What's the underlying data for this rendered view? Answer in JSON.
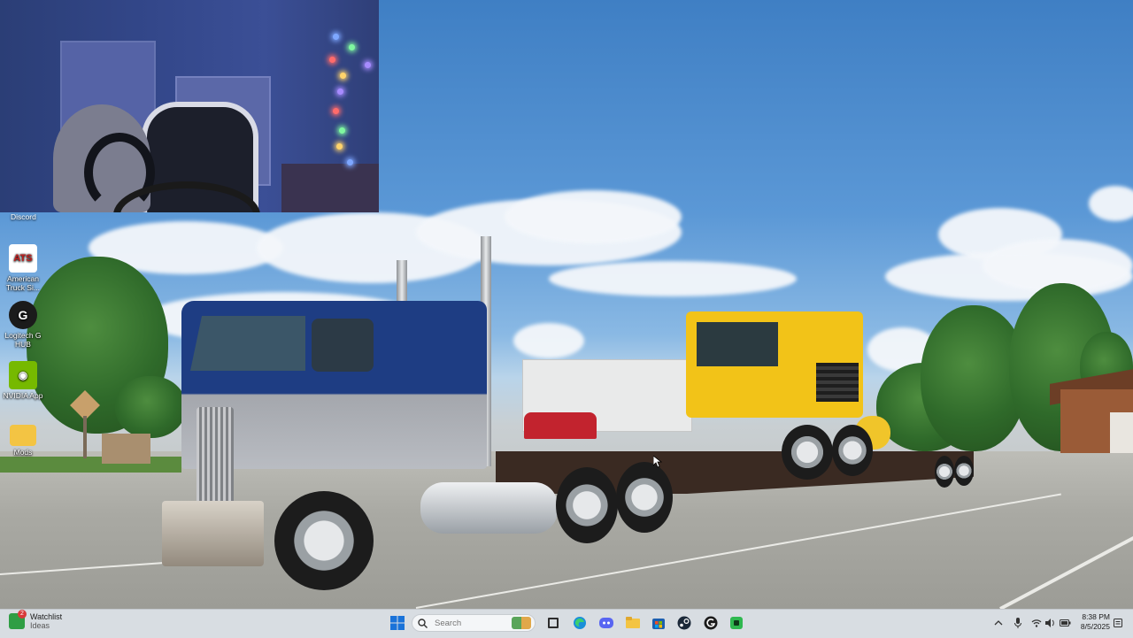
{
  "desktop": {
    "icons": [
      {
        "label": "Discord",
        "icon": "discord-icon"
      },
      {
        "label": "American Truck Si...",
        "icon": "american-truck-simulator-icon"
      },
      {
        "label": "Logitech G HUB",
        "icon": "logitech-g-hub-icon"
      },
      {
        "label": "NVIDIA App",
        "icon": "nvidia-app-icon"
      },
      {
        "label": "Mods",
        "icon": "folder-icon"
      }
    ],
    "colors": {
      "sky": "#4b87c9",
      "truck_blue": "#1e3d83",
      "machine_yellow": "#f2c318"
    }
  },
  "webcam": {
    "label": "webcam-overlay"
  },
  "taskbar": {
    "widget": {
      "title": "Watchlist",
      "subtitle": "Ideas",
      "badge": "2"
    },
    "search": {
      "placeholder": "Search"
    },
    "pinned": [
      {
        "name": "windows-start",
        "icon": "windows-logo-icon"
      },
      {
        "name": "task-view",
        "icon": "task-view-icon"
      },
      {
        "name": "edge",
        "icon": "edge-icon"
      },
      {
        "name": "discord",
        "icon": "discord-icon"
      },
      {
        "name": "file-explorer",
        "icon": "folder-icon"
      },
      {
        "name": "microsoft-store",
        "icon": "store-icon"
      },
      {
        "name": "steam",
        "icon": "steam-icon"
      },
      {
        "name": "logitech-g-hub",
        "icon": "logitech-g-hub-icon"
      },
      {
        "name": "app-green",
        "icon": "green-app-icon"
      }
    ],
    "tray": {
      "chevron": "^",
      "time": "8:38 PM",
      "date": "8/5/2025"
    }
  }
}
